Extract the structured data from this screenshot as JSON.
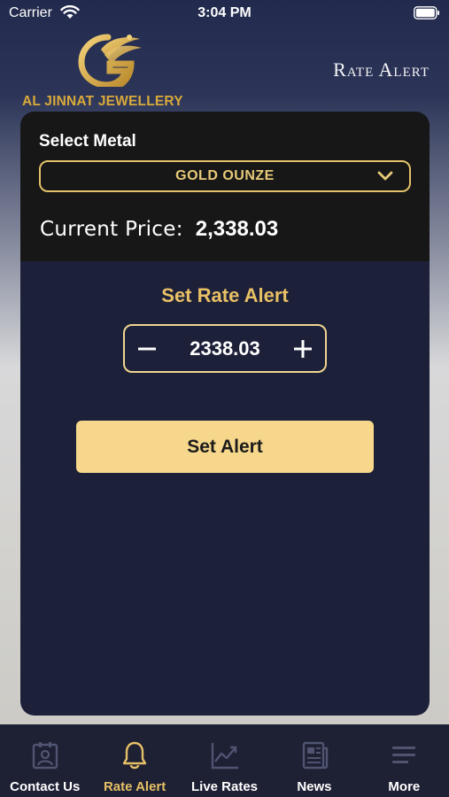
{
  "status_bar": {
    "carrier": "Carrier",
    "time": "3:04 PM"
  },
  "header": {
    "brand_name": "AL JINNAT JEWELLERY",
    "title": "Rate Alert"
  },
  "card": {
    "select_label": "Select Metal",
    "selected_metal": "GOLD OUNZE",
    "current_price_label": "Current Price:",
    "current_price_value": "2,338.03",
    "set_rate_alert_title": "Set Rate Alert",
    "stepper_value": "2338.03",
    "set_alert_button": "Set Alert"
  },
  "tab_bar": {
    "active": "Rate Alert",
    "tabs": [
      {
        "label": "Contact Us",
        "icon": "contact-card-icon"
      },
      {
        "label": "Rate Alert",
        "icon": "bell-icon"
      },
      {
        "label": "Live Rates",
        "icon": "chart-line-icon"
      },
      {
        "label": "News",
        "icon": "newspaper-icon"
      },
      {
        "label": "More",
        "icon": "menu-icon"
      }
    ]
  },
  "colors": {
    "accent_gold": "#e8c065",
    "button_gold": "#f6d78b",
    "card_navy": "#1d2039",
    "card_black": "#171717",
    "tab_bar": "#1e2034"
  }
}
